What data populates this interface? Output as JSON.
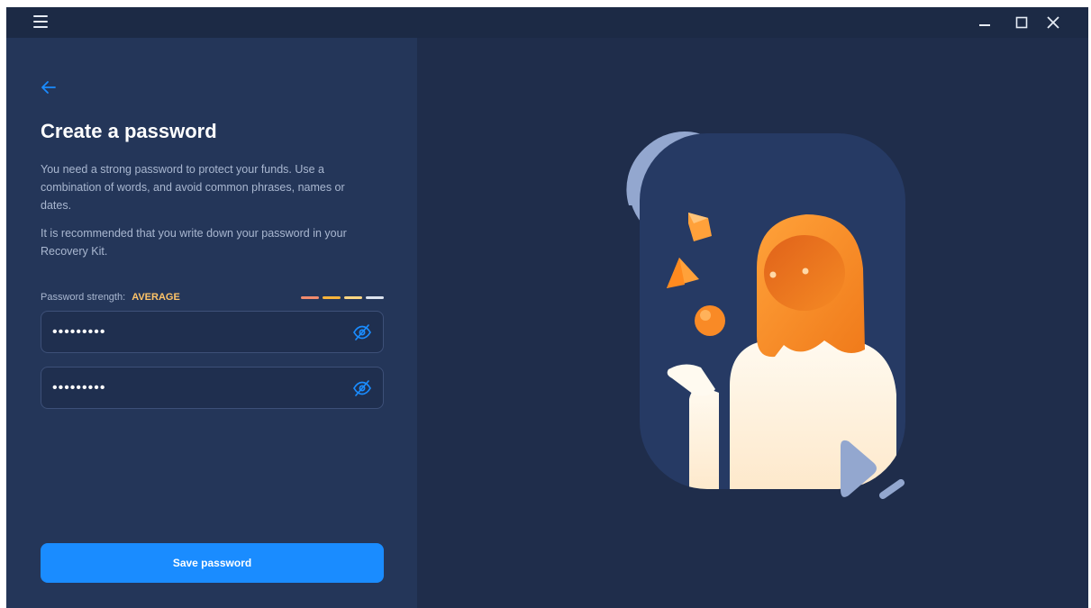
{
  "window": {
    "menu_icon": "hamburger-icon",
    "controls": [
      {
        "name": "minimize",
        "icon": "minimize-icon"
      },
      {
        "name": "maximize",
        "icon": "maximize-icon"
      },
      {
        "name": "close",
        "icon": "close-icon"
      }
    ]
  },
  "form": {
    "back_icon": "arrow-left-icon",
    "title": "Create a password",
    "description": "You need a strong password to protect your funds. Use a combination of words, and avoid common phrases, names or dates.",
    "recommendation": "It is recommended that you write down your password in your Recovery Kit.",
    "strength": {
      "label": "Password strength:",
      "value": "AVERAGE",
      "meter_colors": [
        "#f28b6d",
        "#f9b43a",
        "#ffd782",
        "#dce3ee"
      ]
    },
    "password": {
      "value": "•••••••••",
      "visibility_icon": "eye-off-icon"
    },
    "confirm_password": {
      "value": "•••••••••",
      "visibility_icon": "eye-off-icon"
    },
    "save_label": "Save password"
  },
  "colors": {
    "accent": "#1a8cff",
    "panel": "#243659",
    "background": "#1f2d4b",
    "strength_text": "#ffc468"
  }
}
